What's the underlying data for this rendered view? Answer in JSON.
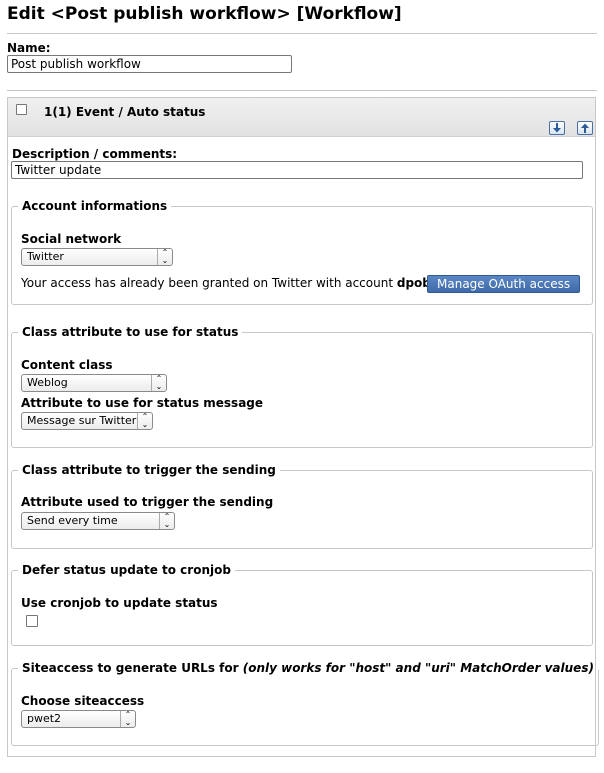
{
  "page": {
    "title": "Edit <Post publish workflow> [Workflow]"
  },
  "name_field": {
    "label": "Name:",
    "value": "Post publish workflow"
  },
  "event": {
    "header": "1(1) Event / Auto status",
    "move_down_icon": "arrow-down-icon",
    "move_up_icon": "arrow-up-icon",
    "description": {
      "label": "Description / comments:",
      "value": "Twitter update"
    }
  },
  "account": {
    "legend": "Account informations",
    "network_label": "Social network",
    "network_value": "Twitter",
    "granted_text": "Your access has already been granted on Twitter with account ",
    "account_name": "dpobel",
    "granted_suffix": ".",
    "manage_button": "Manage OAuth access"
  },
  "status_attr": {
    "legend": "Class attribute to use for status",
    "content_class_label": "Content class",
    "content_class_value": "Weblog",
    "attribute_label": "Attribute to use for status message",
    "attribute_value": "Message sur Twitter"
  },
  "trigger": {
    "legend": "Class attribute to trigger the sending",
    "label": "Attribute used to trigger the sending",
    "value": "Send every time"
  },
  "cron": {
    "legend": "Defer status update to cronjob",
    "label": "Use cronjob to update status"
  },
  "siteaccess": {
    "legend_main": "Siteaccess to generate URLs for ",
    "legend_note": "(only works for \"host\" and \"uri\" MatchOrder values)",
    "label": "Choose siteaccess",
    "value": "pwet2"
  }
}
